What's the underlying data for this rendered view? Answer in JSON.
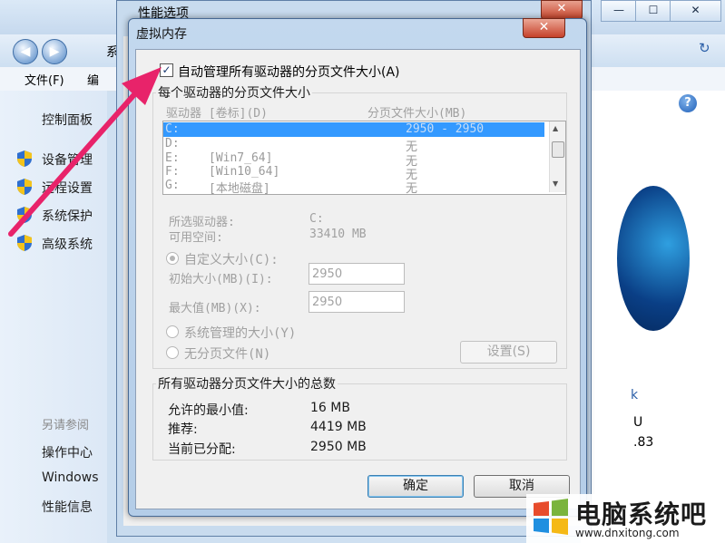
{
  "background": {
    "window_title_partial": "系",
    "controls": {
      "close": "✕",
      "maximize": "☐",
      "minimize": "—"
    },
    "menu": {
      "file": "文件(F)",
      "edit_partial": "编"
    },
    "sidebar": {
      "home": "控制面板",
      "items": [
        {
          "label": "设备管理",
          "icon": "shield-icon"
        },
        {
          "label": "远程设置",
          "icon": "shield-icon"
        },
        {
          "label": "系统保护",
          "icon": "shield-icon"
        },
        {
          "label": "高级系统",
          "icon": "shield-icon"
        }
      ],
      "see_also": "另请参阅",
      "links": [
        "操作中心",
        "Windows",
        "性能信息"
      ]
    },
    "right_fragments": [
      "k",
      "U",
      ".83"
    ]
  },
  "perf_window": {
    "title": "性能选项"
  },
  "dialog": {
    "title": "虚拟内存",
    "close": "✕",
    "auto_manage": {
      "label": "自动管理所有驱动器的分页文件大小(A)",
      "checked": true,
      "mark": "✓"
    },
    "per_drive_group": "每个驱动器的分页文件大小",
    "columns": {
      "drive": "驱动器 [卷标](D)",
      "size": "分页文件大小(MB)"
    },
    "drives": [
      {
        "drive": "C:",
        "label": "",
        "size": "2950 - 2950",
        "selected": true
      },
      {
        "drive": "D:",
        "label": "",
        "size": "无"
      },
      {
        "drive": "E:",
        "label": "[Win7_64]",
        "size": "无"
      },
      {
        "drive": "F:",
        "label": "[Win10_64]",
        "size": "无"
      },
      {
        "drive": "G:",
        "label": "[本地磁盘]",
        "size": "无"
      }
    ],
    "selected_drive_label": "所选驱动器:",
    "selected_drive_value": "C:",
    "free_space_label": "可用空间:",
    "free_space_value": "33410 MB",
    "custom_size": "自定义大小(C):",
    "initial_label": "初始大小(MB)(I):",
    "initial_value": "2950",
    "max_label": "最大值(MB)(X):",
    "max_value": "2950",
    "system_managed": "系统管理的大小(Y)",
    "no_paging": "无分页文件(N)",
    "set_button": "设置(S)",
    "totals_group": "所有驱动器分页文件大小的总数",
    "min_allowed_label": "允许的最小值:",
    "min_allowed_value": "16 MB",
    "recommended_label": "推荐:",
    "recommended_value": "4419 MB",
    "allocated_label": "当前已分配:",
    "allocated_value": "2950 MB",
    "ok": "确定",
    "cancel": "取消"
  },
  "watermark": {
    "name": "电脑系统吧",
    "url": "www.dnxitong.com"
  },
  "colors": {
    "selection": "#3399ff",
    "arrow": "#e8236a",
    "dialog_frame": "#b4cde8"
  }
}
